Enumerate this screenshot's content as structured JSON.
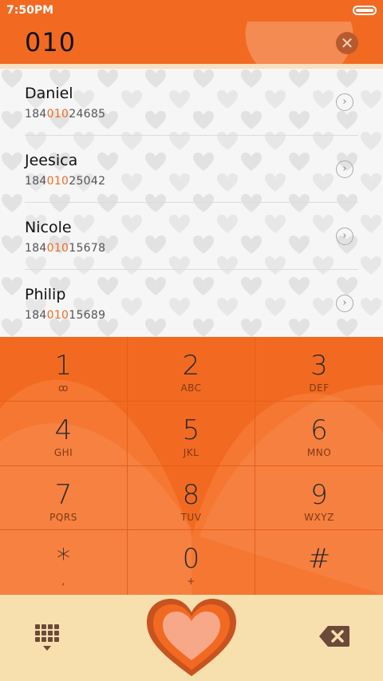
{
  "status": {
    "time": "7:50PM"
  },
  "header": {
    "dialed_number": "010",
    "clear_icon": "close-circle-icon"
  },
  "contacts": [
    {
      "name": "Daniel",
      "phone_prefix": "184",
      "phone_match": "010",
      "phone_suffix": "24685"
    },
    {
      "name": "Jeesica",
      "phone_prefix": "184",
      "phone_match": "010",
      "phone_suffix": "25042"
    },
    {
      "name": "Nicole",
      "phone_prefix": "184",
      "phone_match": "010",
      "phone_suffix": "15678"
    },
    {
      "name": "Philip",
      "phone_prefix": "184",
      "phone_match": "010",
      "phone_suffix": "15689"
    }
  ],
  "keypad": [
    {
      "digit": "1",
      "letters": "ꝏ"
    },
    {
      "digit": "2",
      "letters": "ABC"
    },
    {
      "digit": "3",
      "letters": "DEF"
    },
    {
      "digit": "4",
      "letters": "GHI"
    },
    {
      "digit": "5",
      "letters": "JKL"
    },
    {
      "digit": "6",
      "letters": "MNO"
    },
    {
      "digit": "7",
      "letters": "PQRS"
    },
    {
      "digit": "8",
      "letters": "TUV"
    },
    {
      "digit": "9",
      "letters": "WXYZ"
    },
    {
      "digit": "*",
      "letters": ","
    },
    {
      "digit": "0",
      "letters": "+"
    },
    {
      "digit": "#",
      "letters": ""
    }
  ],
  "bottom": {
    "grid_icon": "dialpad-icon",
    "call_icon": "heart-call-icon",
    "backspace_icon": "backspace-icon"
  },
  "colors": {
    "accent": "#f26a21",
    "bottom_bg": "#f8dfae",
    "match_highlight": "#f26a21"
  }
}
